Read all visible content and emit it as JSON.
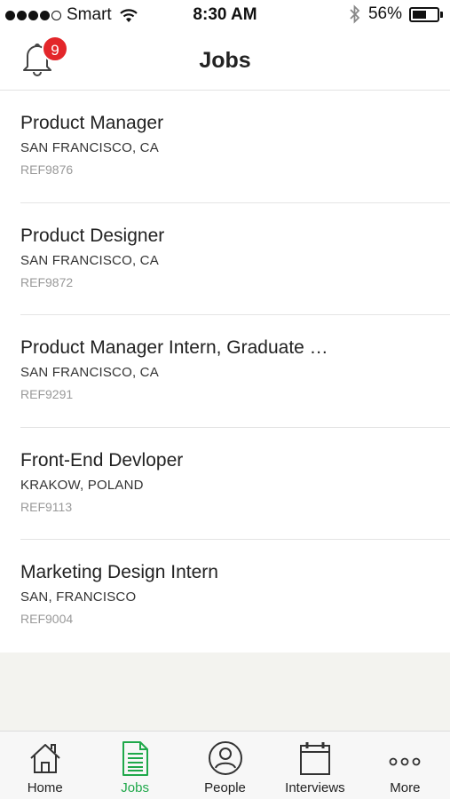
{
  "status_bar": {
    "carrier": "Smart",
    "time": "8:30 AM",
    "battery": "56%",
    "battery_level": 0.56
  },
  "header": {
    "title": "Jobs",
    "notification_count": "9"
  },
  "jobs": [
    {
      "title": "Product Manager",
      "location": "SAN FRANCISCO, CA",
      "ref": "REF9876"
    },
    {
      "title": "Product Designer",
      "location": "SAN FRANCISCO, CA",
      "ref": "REF9872"
    },
    {
      "title": "Product Manager Intern, Graduate …",
      "location": "SAN FRANCISCO, CA",
      "ref": "REF9291"
    },
    {
      "title": "Front-End Devloper",
      "location": "KRAKOW, POLAND",
      "ref": "REF9113"
    },
    {
      "title": "Marketing Design Intern",
      "location": "SAN, FRANCISCO",
      "ref": "REF9004"
    }
  ],
  "tabs": [
    {
      "label": "Home",
      "icon": "home-icon"
    },
    {
      "label": "Jobs",
      "icon": "document-icon",
      "active": true
    },
    {
      "label": "People",
      "icon": "person-icon"
    },
    {
      "label": "Interviews",
      "icon": "calendar-icon"
    },
    {
      "label": "More",
      "icon": "more-icon"
    }
  ],
  "colors": {
    "accent": "#1fa84a",
    "badge": "#e3262a"
  }
}
